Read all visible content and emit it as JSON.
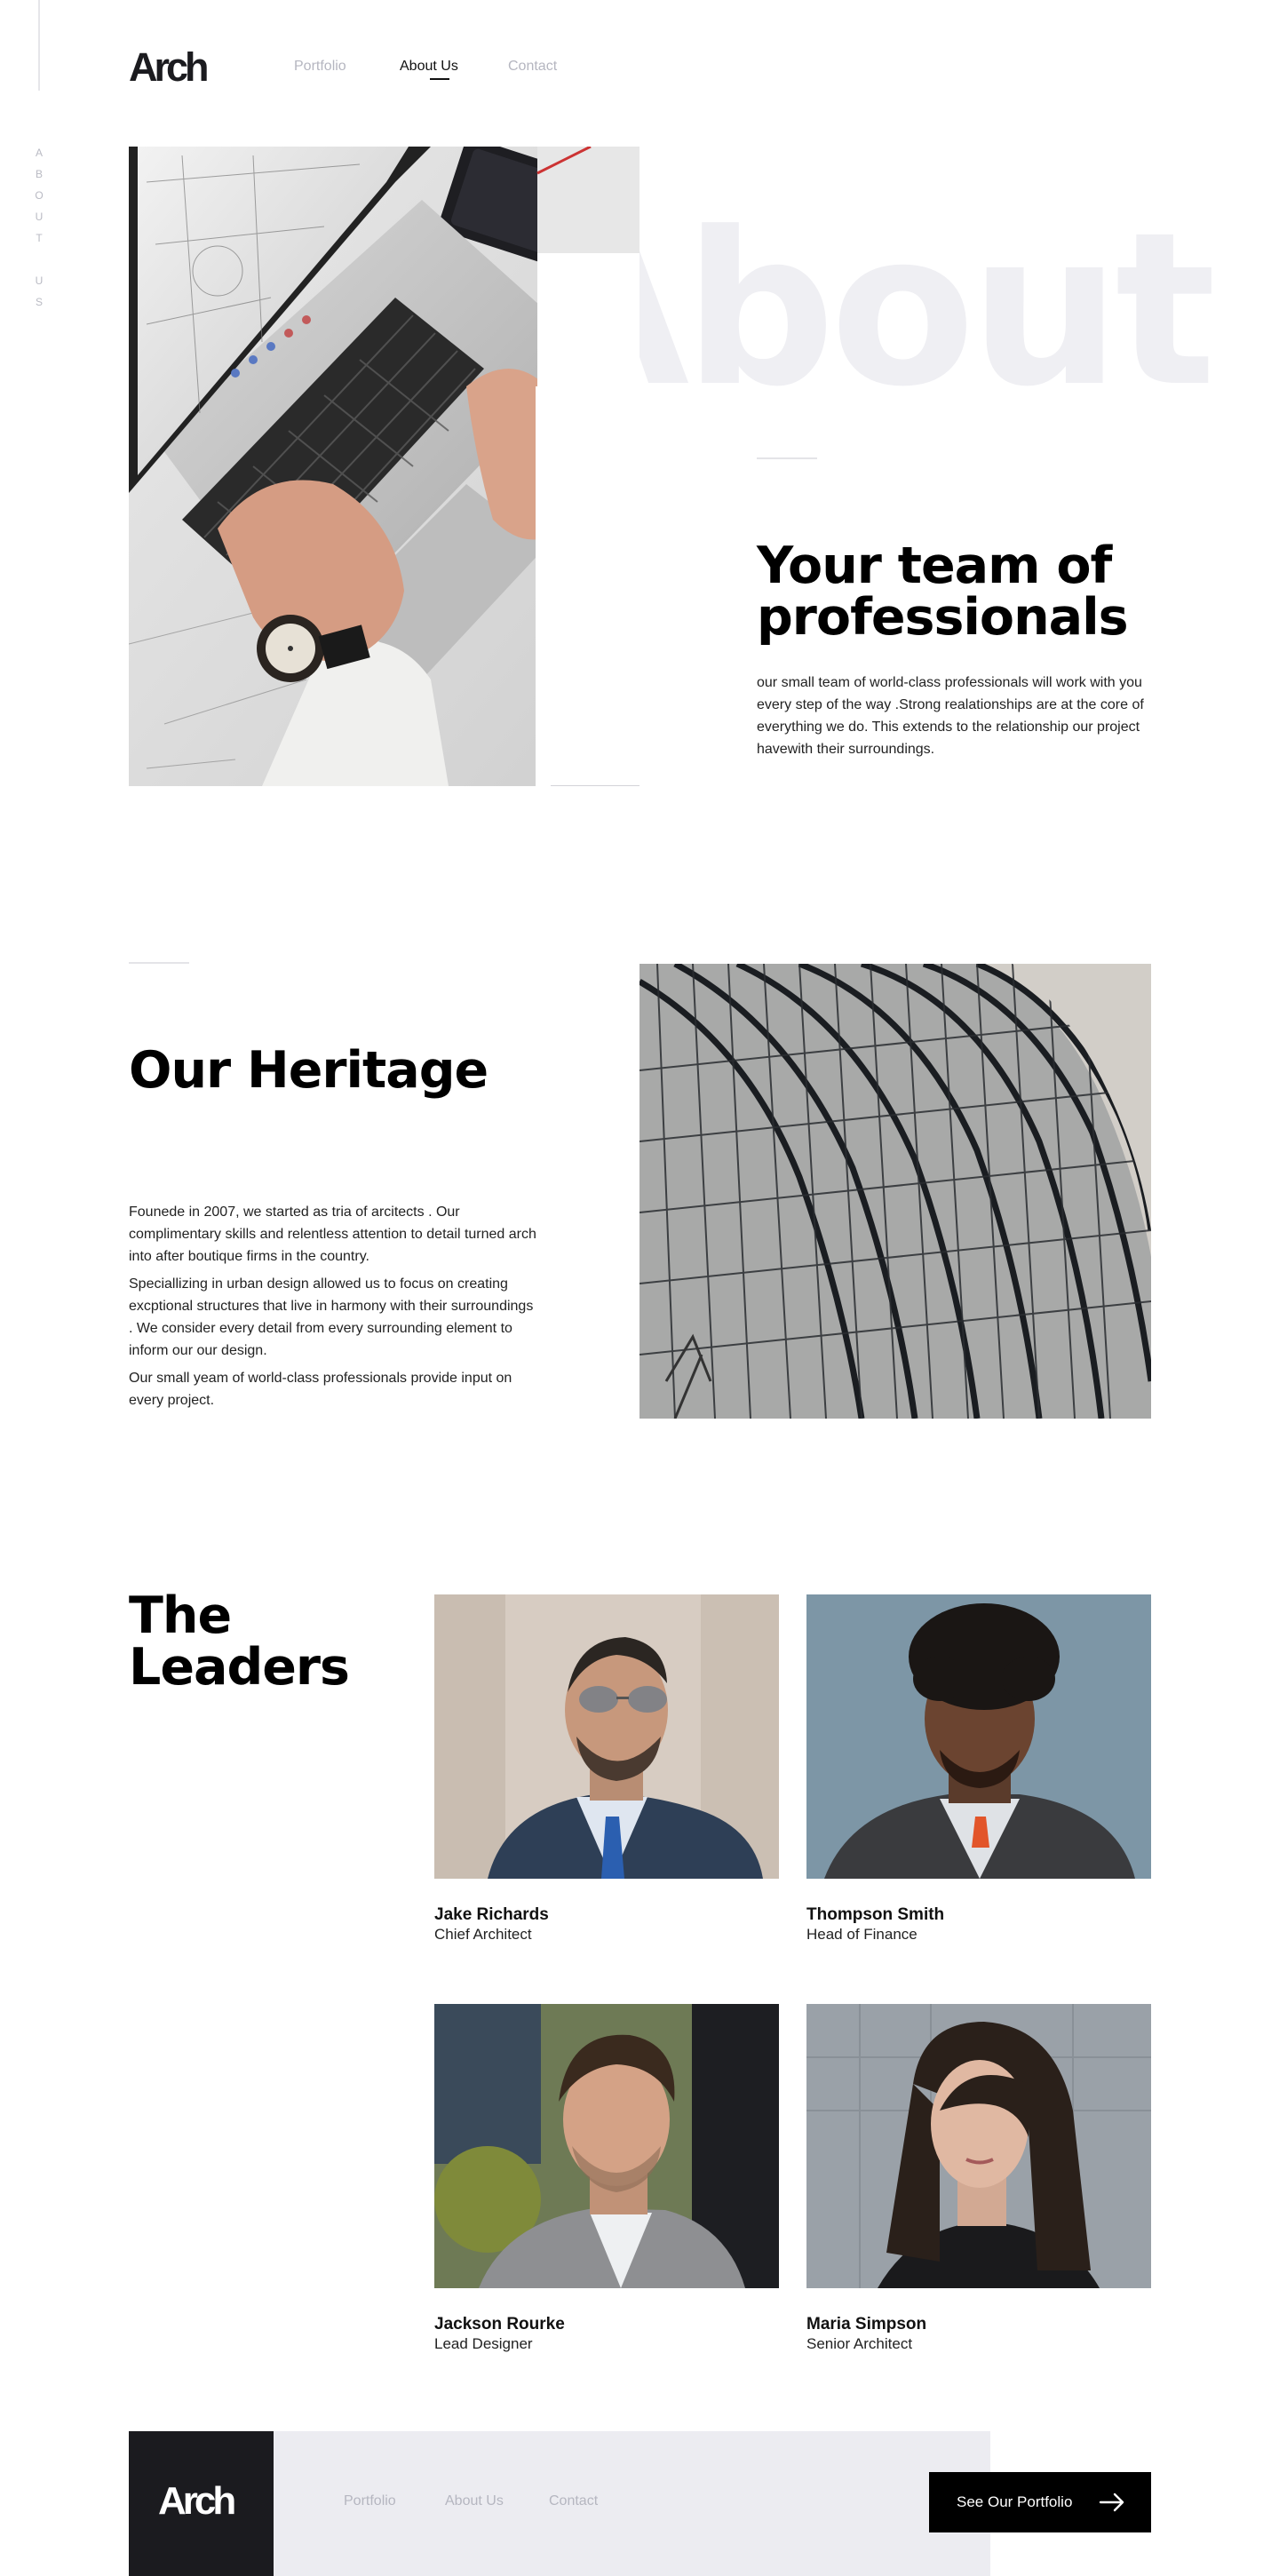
{
  "brand": {
    "logo": "Arch"
  },
  "side_label": "ABOUT US",
  "nav": {
    "items": [
      {
        "label": "Portfolio",
        "active": false
      },
      {
        "label": "About Us",
        "active": true
      },
      {
        "label": "Contact",
        "active": false
      }
    ]
  },
  "hero": {
    "watermark": "About",
    "heading": "Your team of professionals",
    "text": "our small team of world-class professionals will work with you every step of the way .Strong realationships are at the core of everything we do. This extends to the relationship our project havewith their surroundings."
  },
  "heritage": {
    "heading": "Our Heritage",
    "paragraphs": [
      "Founede in 2007, we started as tria of arcitects . Our complimentary skills and relentless attention to detail turned arch into after boutique firms in the country.",
      "Speciallizing in urban design allowed us to focus on creating excptional structures that live in harmony with their surroundings . We consider every detail from every surrounding element to inform our our design.",
      "Our small yeam of world-class professionals provide input on every project."
    ]
  },
  "leaders": {
    "heading": "The Leaders",
    "people": [
      {
        "name": "Jake Richards",
        "role": "Chief Architect"
      },
      {
        "name": "Thompson Smith",
        "role": "Head of Finance"
      },
      {
        "name": "Jackson Rourke",
        "role": "Lead Designer"
      },
      {
        "name": "Maria Simpson",
        "role": "Senior Architect"
      }
    ]
  },
  "footer": {
    "logo": "Arch",
    "nav": [
      "Portfolio",
      "About Us",
      "Contact"
    ],
    "cta_label": "See Our Portfolio",
    "cta_icon": "arrow-right-icon"
  },
  "colors": {
    "accent_dark": "#1b1b1f",
    "muted_nav": "#b5b6c0",
    "watermark": "#efeff3",
    "footer_bg": "#ececf1"
  }
}
